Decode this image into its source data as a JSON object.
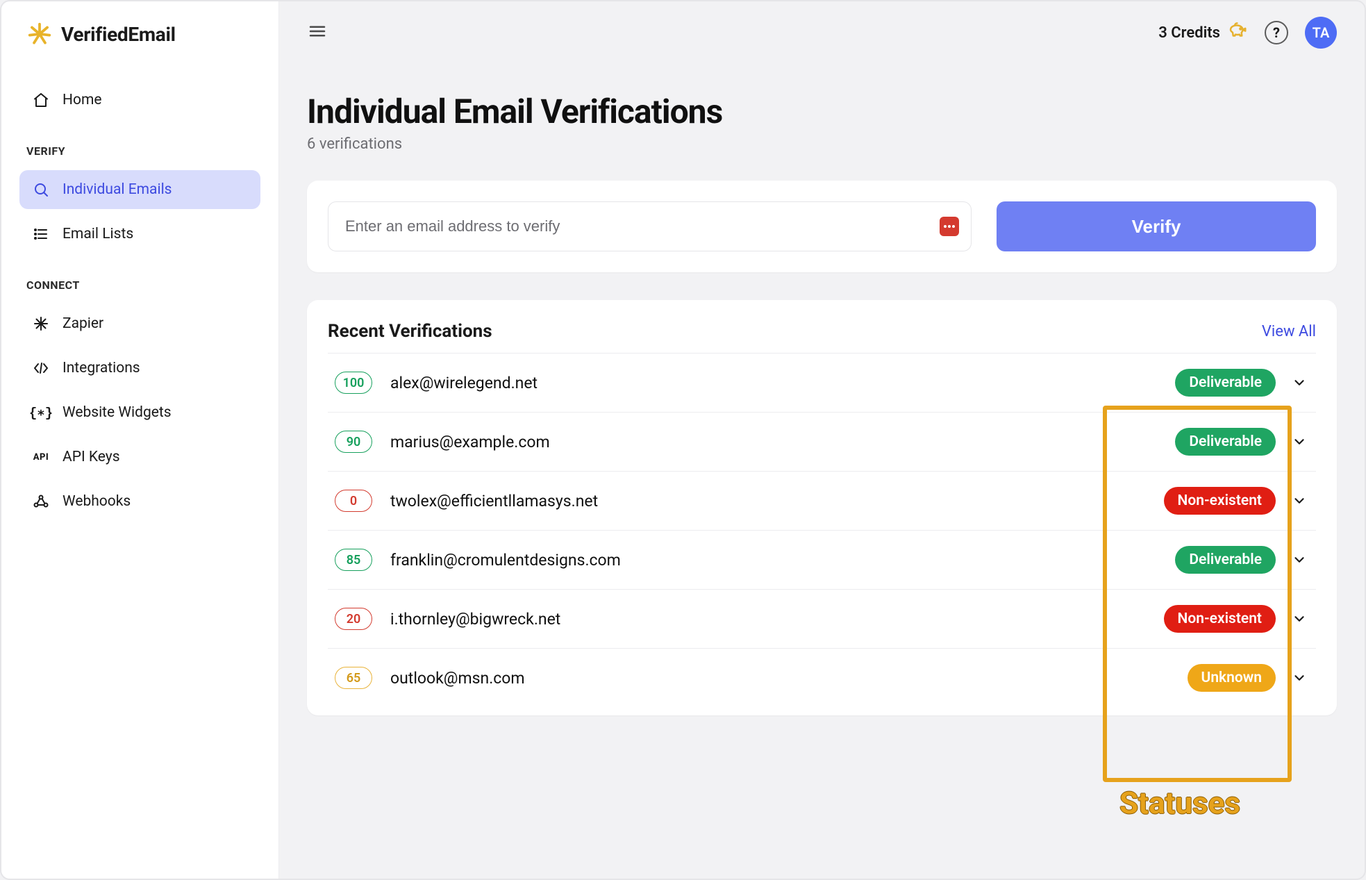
{
  "brand": {
    "name": "VerifiedEmail"
  },
  "sidebar": {
    "home_label": "Home",
    "group_verify": "VERIFY",
    "group_connect": "CONNECT",
    "items": {
      "individual": "Individual Emails",
      "lists": "Email Lists",
      "zapier": "Zapier",
      "integrations": "Integrations",
      "widgets": "Website Widgets",
      "api": "API Keys",
      "webhooks": "Webhooks"
    }
  },
  "topbar": {
    "credits_label": "3 Credits",
    "help": "?",
    "avatar_initials": "TA"
  },
  "page": {
    "title": "Individual Email Verifications",
    "subtitle": "6 verifications"
  },
  "verify_form": {
    "placeholder": "Enter an email address to verify",
    "button": "Verify"
  },
  "recent": {
    "title": "Recent Verifications",
    "view_all": "View All",
    "rows": [
      {
        "score": "100",
        "score_class": "green",
        "email": "alex@wirelegend.net",
        "status": "Deliverable",
        "status_class": "deliverable"
      },
      {
        "score": "90",
        "score_class": "green",
        "email": "marius@example.com",
        "status": "Deliverable",
        "status_class": "deliverable"
      },
      {
        "score": "0",
        "score_class": "red",
        "email": "twolex@efficientllamasys.net",
        "status": "Non-existent",
        "status_class": "nonexistent"
      },
      {
        "score": "85",
        "score_class": "green",
        "email": "franklin@cromulentdesigns.com",
        "status": "Deliverable",
        "status_class": "deliverable"
      },
      {
        "score": "20",
        "score_class": "red",
        "email": "i.thornley@bigwreck.net",
        "status": "Non-existent",
        "status_class": "nonexistent"
      },
      {
        "score": "65",
        "score_class": "yellow",
        "email": "outlook@msn.com",
        "status": "Unknown",
        "status_class": "unknown"
      }
    ]
  },
  "annotation": {
    "label": "Statuses"
  }
}
